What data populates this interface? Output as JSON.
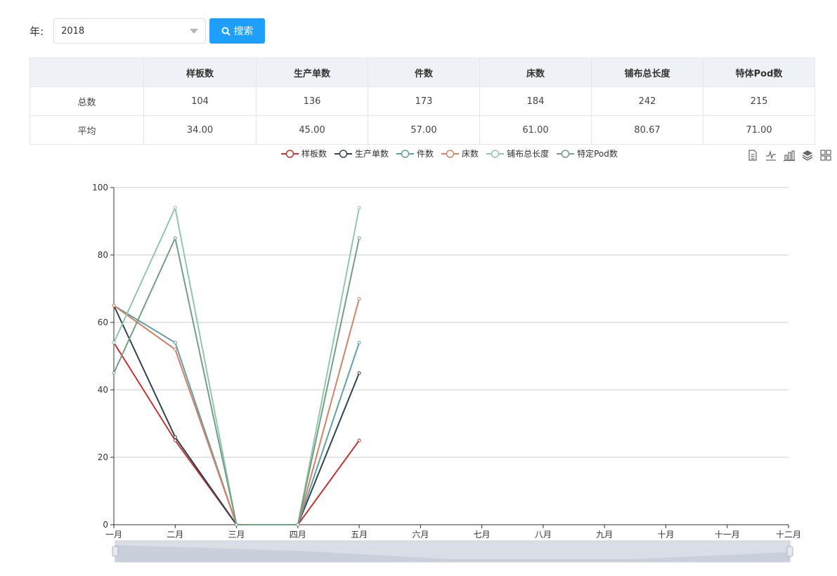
{
  "filter": {
    "year_label": "年:",
    "year_value": "2018",
    "search_label": "搜索"
  },
  "table": {
    "headers": [
      "",
      "样板数",
      "生产单数",
      "件数",
      "床数",
      "铺布总长度",
      "特体Pod数"
    ],
    "rows": [
      {
        "label": "总数",
        "values": [
          "104",
          "136",
          "173",
          "184",
          "242",
          "215"
        ]
      },
      {
        "label": "平均",
        "values": [
          "34.00",
          "45.00",
          "57.00",
          "61.00",
          "80.67",
          "71.00"
        ]
      }
    ]
  },
  "toolbox": [
    "data-view-icon",
    "line-icon",
    "bar-icon",
    "stack-icon",
    "tiled-icon"
  ],
  "chart_data": {
    "type": "line",
    "categories": [
      "一月",
      "二月",
      "三月",
      "四月",
      "五月",
      "六月",
      "七月",
      "八月",
      "九月",
      "十月",
      "十一月",
      "十二月"
    ],
    "ylim": [
      0,
      100
    ],
    "yticks": [
      0,
      20,
      40,
      60,
      80,
      100
    ],
    "grid": true,
    "legend_position": "top",
    "data_zoom": true,
    "series": [
      {
        "name": "样板数",
        "color": "#c23531",
        "values": [
          54,
          25,
          0,
          0,
          25
        ]
      },
      {
        "name": "生产单数",
        "color": "#2f4554",
        "values": [
          65,
          26,
          0,
          0,
          45
        ]
      },
      {
        "name": "件数",
        "color": "#61a0a8",
        "values": [
          65,
          54,
          0,
          0,
          54
        ]
      },
      {
        "name": "床数",
        "color": "#d48265",
        "values": [
          65,
          52,
          0,
          0,
          67
        ]
      },
      {
        "name": "铺布总长度",
        "color": "#91c7ae",
        "values": [
          54,
          94,
          0,
          0,
          94
        ]
      },
      {
        "name": "特定Pod数",
        "color": "#749f83",
        "values": [
          45,
          85,
          0,
          0,
          85
        ]
      }
    ]
  }
}
